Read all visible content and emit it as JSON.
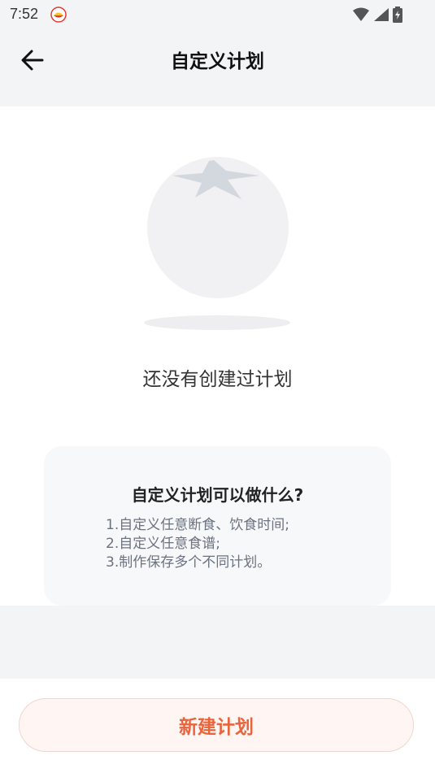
{
  "status_bar": {
    "time": "7:52"
  },
  "header": {
    "title": "自定义计划"
  },
  "empty_state": {
    "message": "还没有创建过计划"
  },
  "info_card": {
    "title": "自定义计划可以做什么?",
    "items": [
      "1.自定义任意断食、饮食时间;",
      "2.自定义任意食谱;",
      "3.制作保存多个不同计划。"
    ]
  },
  "footer": {
    "new_plan_label": "新建计划"
  },
  "colors": {
    "accent": "#e8643c",
    "button_bg": "#fff5f2",
    "page_bg": "#f3f4f6",
    "card_bg": "#f7f8fa"
  }
}
